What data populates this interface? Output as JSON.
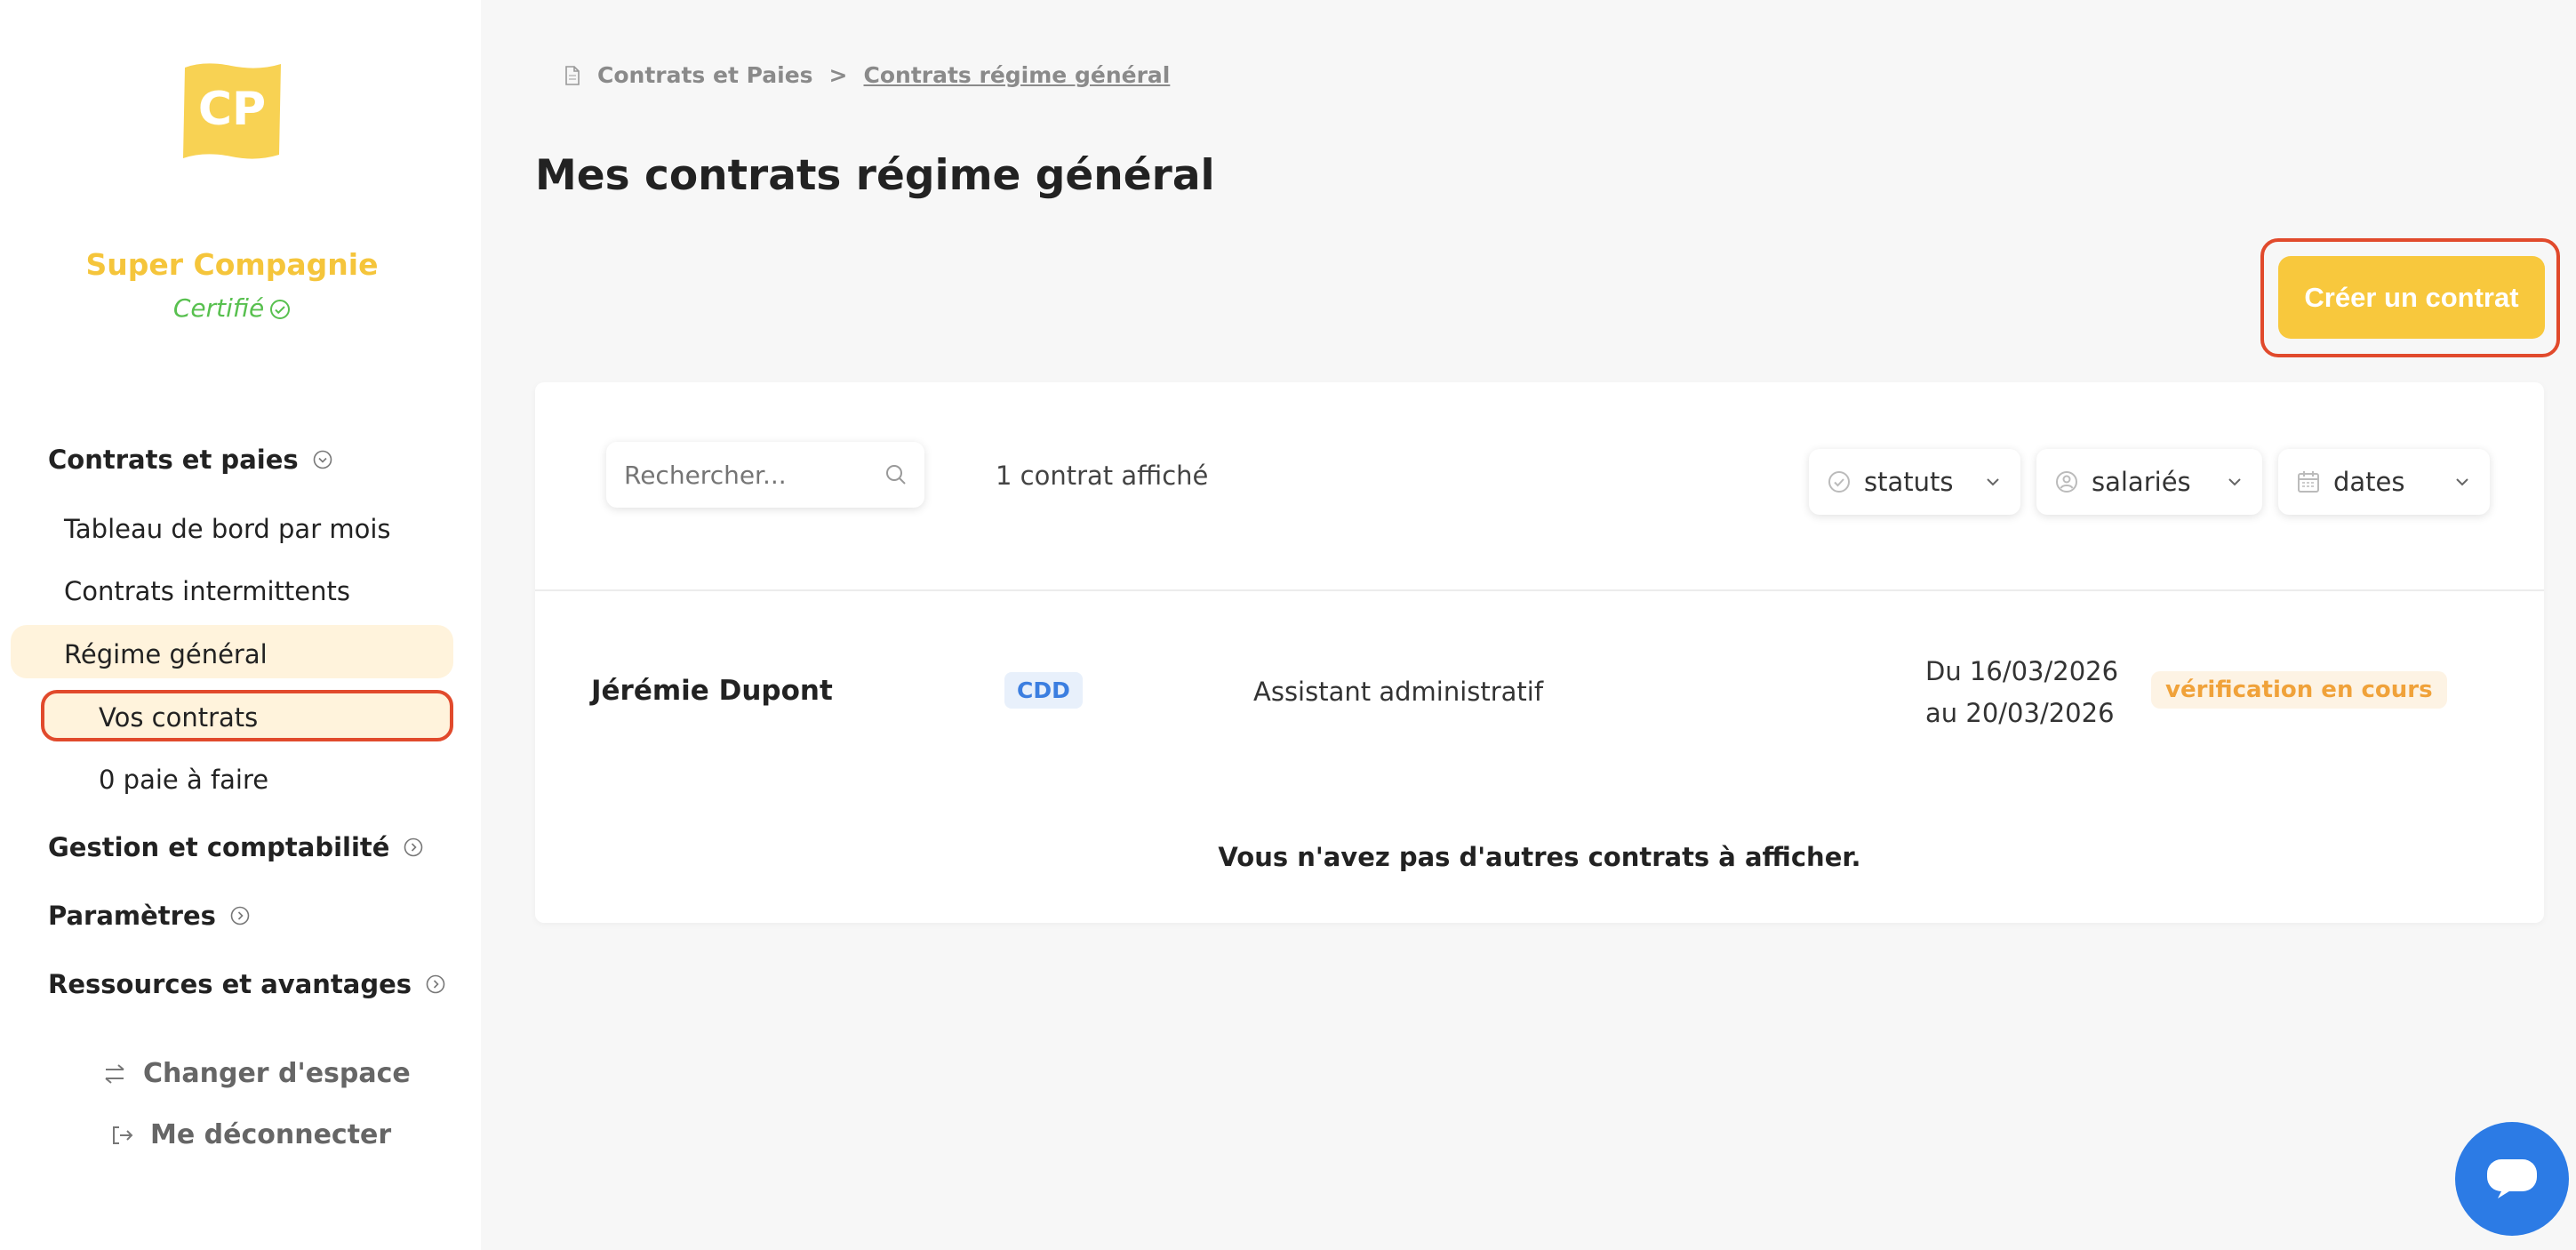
{
  "company": {
    "logo_text": "CP",
    "name": "Super Compagnie",
    "certified": "Certifié"
  },
  "sidebar": {
    "sections": [
      {
        "label": "Contrats et paies"
      },
      {
        "label": "Gestion et comptabilité"
      },
      {
        "label": "Paramètres"
      },
      {
        "label": "Ressources et avantages"
      }
    ],
    "items": [
      {
        "label": "Tableau de bord par mois"
      },
      {
        "label": "Contrats intermittents"
      },
      {
        "label": "Régime général"
      },
      {
        "label": "Vos contrats"
      },
      {
        "label": "0 paie à faire"
      }
    ],
    "switch_space": "Changer d'espace",
    "logout": "Me déconnecter"
  },
  "breadcrumb": {
    "parent": "Contrats et Paies",
    "separator": ">",
    "current": "Contrats régime général"
  },
  "page": {
    "title": "Mes contrats régime général",
    "create_button": "Créer un contrat"
  },
  "toolbar": {
    "search_placeholder": "Rechercher...",
    "count_text": "1 contrat affiché",
    "filters": {
      "statuts": "statuts",
      "salaries": "salariés",
      "dates": "dates"
    }
  },
  "contracts": [
    {
      "employee": "Jérémie Dupont",
      "type": "CDD",
      "role": "Assistant administratif",
      "date_from": "Du 16/03/2026",
      "date_to": "au 20/03/2026",
      "status": "vérification en cours"
    }
  ],
  "empty_message": "Vous n'avez pas d'autres contrats à afficher.",
  "colors": {
    "accent": "#f8c83d",
    "highlight": "#fff3dc",
    "annotation": "#e14a2c",
    "chat": "#2c7be5",
    "certified": "#58c04f"
  }
}
